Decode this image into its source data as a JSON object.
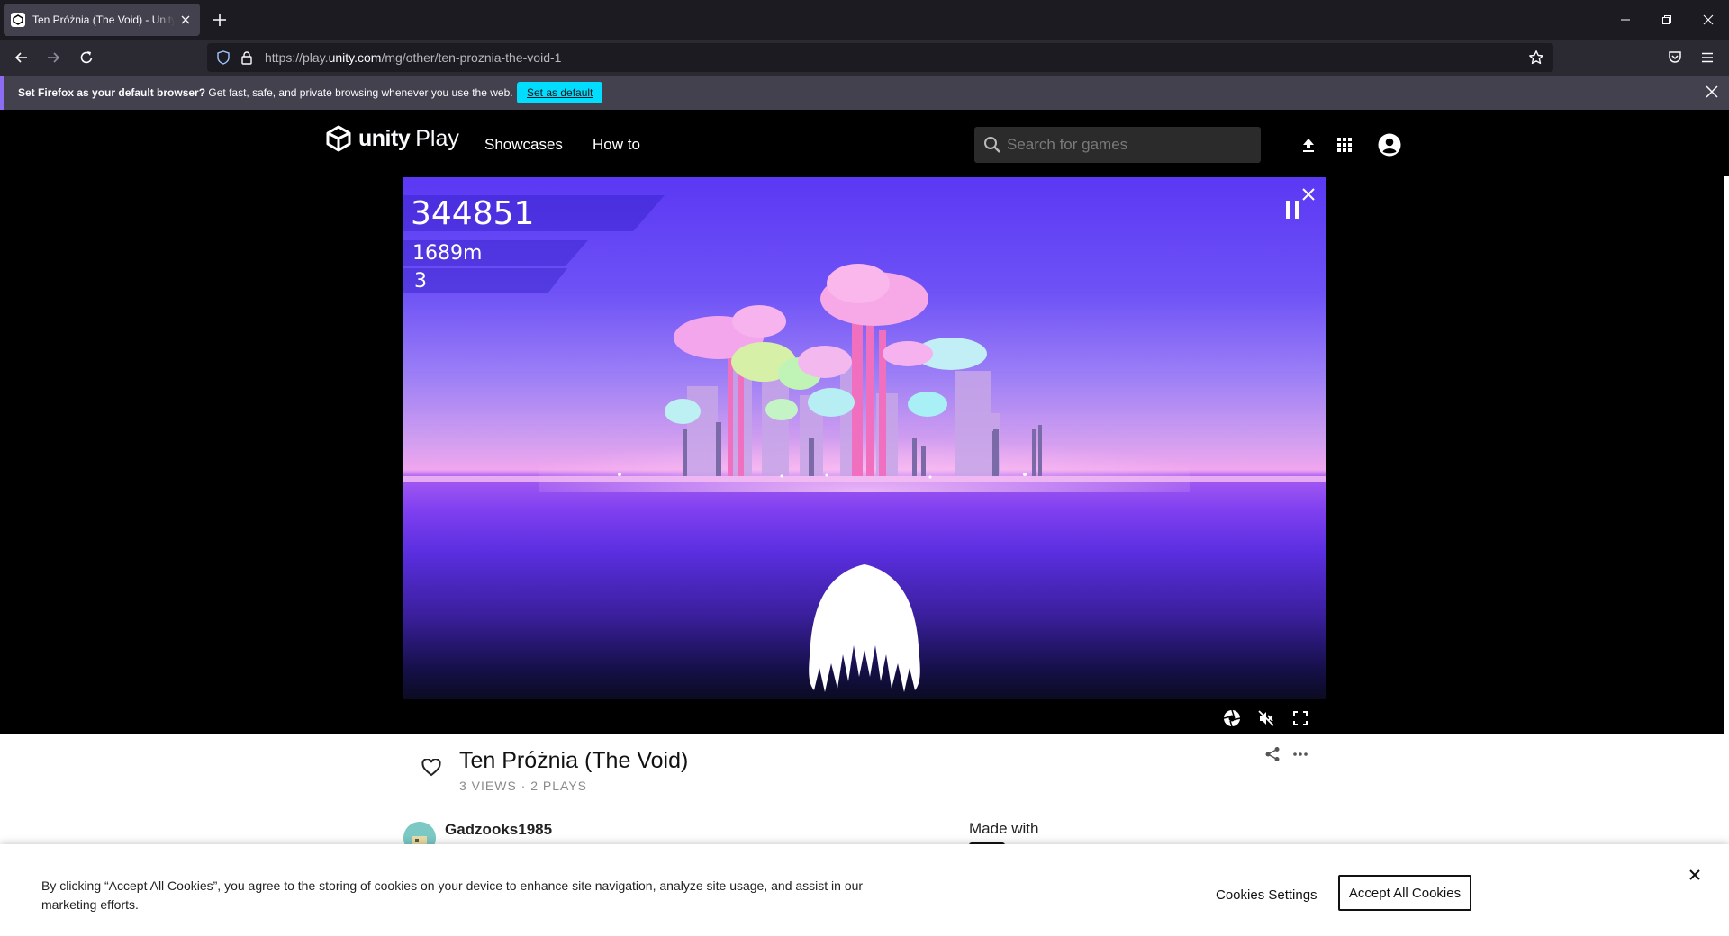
{
  "browser": {
    "tab_title": "Ten Próżnia (The Void) - Unity Play",
    "url_prefix": "https://play.",
    "url_domain": "unity.com",
    "url_path": "/mg/other/ten-proznia-the-void-1"
  },
  "notification": {
    "bold_text": "Set Firefox as your default browser?",
    "text": " Get fast, safe, and private browsing whenever you use the web.",
    "button_label": "Set as default"
  },
  "site": {
    "logo_unity": "unity",
    "logo_play": "Play",
    "nav": [
      "Showcases",
      "How to"
    ],
    "search_placeholder": "Search for games"
  },
  "game": {
    "score": "344851",
    "distance": "1689m",
    "count": "3"
  },
  "details": {
    "title": "Ten Próżnia (The Void)",
    "stats": "3 VIEWS · 2 PLAYS",
    "author": "Gadzooks1985",
    "made_with": "Made with"
  },
  "cookie": {
    "text": "By clicking “Accept All Cookies”, you agree to the storing of cookies on your device to enhance site navigation, analyze site usage, and assist in our marketing efforts.",
    "settings_label": "Cookies Settings",
    "accept_label": "Accept All Cookies"
  },
  "colors": {
    "accent_cyan": "#00ddff",
    "game_sky": "#5b38f4",
    "game_horizon": "#f0a6ee"
  }
}
